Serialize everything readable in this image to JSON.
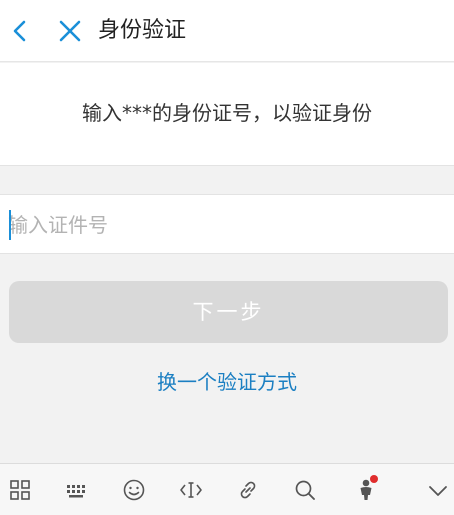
{
  "header": {
    "title": "身份验证",
    "back_icon": "chevron-left-icon",
    "close_icon": "close-icon"
  },
  "prompt": {
    "text": "输入***的身份证号，以验证身份"
  },
  "id_input": {
    "value": "",
    "placeholder": "输入证件号"
  },
  "next_button": {
    "label": "下一步",
    "state": "disabled"
  },
  "switch_link": {
    "label": "换一个验证方式"
  },
  "keyboard_toolbar": {
    "items": [
      {
        "icon": "grid-icon"
      },
      {
        "icon": "keyboard-icon"
      },
      {
        "icon": "emoji-icon"
      },
      {
        "icon": "cursor-move-icon"
      },
      {
        "icon": "link-icon"
      },
      {
        "icon": "search-icon"
      },
      {
        "icon": "avatar-icon",
        "badge": true
      },
      {
        "icon": "chevron-down-icon"
      }
    ]
  },
  "colors": {
    "accent": "#1a8fd8",
    "link": "#1b7fc2",
    "button_disabled_bg": "#d9d9d9",
    "badge": "#e02d2d"
  }
}
